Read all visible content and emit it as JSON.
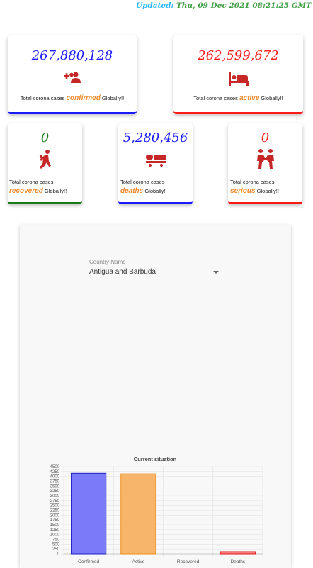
{
  "header": {
    "updated_label": "Updated:",
    "updated_value": "Thu, 09 Dec 2021 08:21:25 GMT"
  },
  "cards": {
    "confirmed": {
      "value": "267,880,128",
      "prefix": "Total corona cases",
      "keyword": "confirmed",
      "suffix": "Globally!!",
      "icon": "add-people-icon",
      "value_color": "#1a1aff",
      "border_color": "#1a1aff"
    },
    "active": {
      "value": "262,599,672",
      "prefix": "Total corona cases",
      "keyword": "active",
      "suffix": "Globally!!",
      "icon": "hospital-bed-icon",
      "value_color": "#ff1a1a",
      "border_color": "#ff1a1a"
    },
    "recovered": {
      "value": "0",
      "prefix": "Total corona cases",
      "keyword": "recovered",
      "suffix": "Globally!!",
      "icon": "person-active-icon",
      "value_color": "#1b7a1b",
      "border_color": "#1b7a1b"
    },
    "deaths": {
      "value": "5,280,456",
      "prefix": "Total corona cases",
      "keyword": "deaths",
      "suffix": "Globally!!",
      "icon": "stretcher-icon",
      "value_color": "#1a1aff",
      "border_color": "#1a1aff"
    },
    "serious": {
      "value": "0",
      "prefix": "Total corona cases",
      "keyword": "serious",
      "suffix": "Globally!!",
      "icon": "people-helping-icon",
      "value_color": "#ff1a1a",
      "border_color": "#ff1a1a"
    }
  },
  "country_select": {
    "label": "Country Name",
    "value": "Antigua and Barbuda"
  },
  "chart_data": {
    "type": "bar",
    "title": "Current situation",
    "categories": [
      "Confirmed",
      "Active",
      "Recovered",
      "Deaths"
    ],
    "values": [
      4160,
      4130,
      0,
      110
    ],
    "ylim": [
      0,
      4500
    ],
    "yticks": [
      0,
      250,
      500,
      750,
      1000,
      1250,
      1500,
      1750,
      2000,
      2250,
      2500,
      2750,
      3000,
      3250,
      3500,
      3750,
      4000,
      4250,
      4500
    ],
    "ytick_labels": [
      "0",
      "250",
      "500",
      "750",
      "1000",
      "1250",
      "1500",
      "1750",
      "2000",
      "2250",
      "2500",
      "2750",
      "3000",
      "3250",
      "3500",
      "3750",
      "4000",
      "4250",
      "4500"
    ],
    "grid": true,
    "bar_fills": [
      "#7b7bfa",
      "#f7b56b",
      "#9bd49b",
      "#f97a7a"
    ],
    "bar_strokes": [
      "#1e1ec8",
      "#f08c14",
      "#2e9e2e",
      "#e01e1e"
    ]
  }
}
